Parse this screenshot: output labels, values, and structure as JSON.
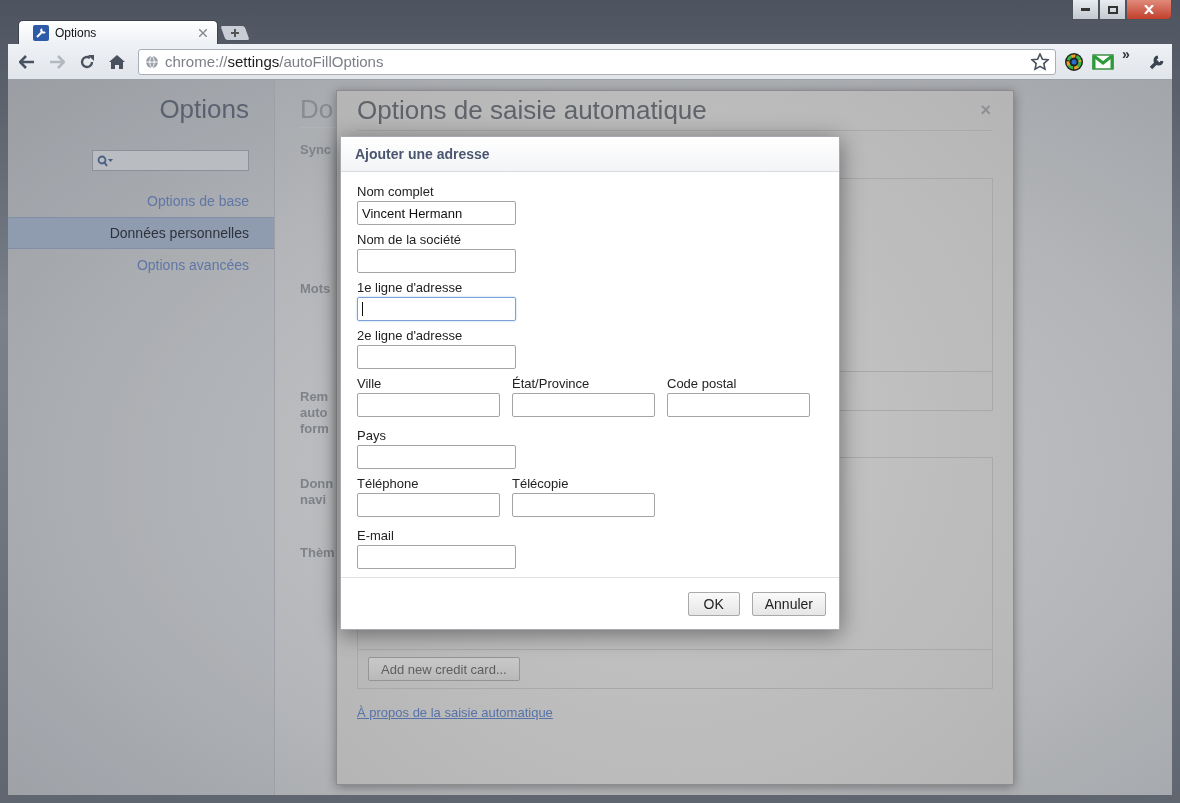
{
  "tab": {
    "title": "Options",
    "selected": true
  },
  "toolbar": {
    "buttons": [
      {
        "kind": "back",
        "disabled": false
      },
      {
        "kind": "forward",
        "disabled": true
      },
      {
        "kind": "reload",
        "disabled": false
      },
      {
        "kind": "home",
        "disabled": false
      }
    ],
    "url": {
      "scheme": "chrome://",
      "host": "settings",
      "path": "/autoFillOptions"
    },
    "overflow": "»"
  },
  "sidebar": {
    "title": "Options",
    "items": [
      {
        "label": "Options de base",
        "selected": false
      },
      {
        "label": "Données personnelles",
        "selected": true
      },
      {
        "label": "Options avancées",
        "selected": false
      }
    ]
  },
  "main": {
    "title": "Do",
    "sections": [
      {
        "lines": [
          "Sync"
        ]
      },
      {
        "lines": [
          "Mots"
        ]
      },
      {
        "lines": [
          "Rem",
          "auto",
          "form"
        ]
      },
      {
        "lines": [
          "Donn",
          "navi"
        ]
      },
      {
        "lines": [
          "Thèm"
        ]
      }
    ]
  },
  "autofill_dialog": {
    "title": "Options de saisie automatique",
    "close": "×",
    "add_card_button": "Add new credit card...",
    "link": "À propos de la saisie automatique"
  },
  "address_dialog": {
    "title": "Ajouter une adresse",
    "rows": [
      {
        "fields": [
          {
            "label": "Nom complet",
            "value": "Vincent Hermann",
            "focused": false
          }
        ]
      },
      {
        "fields": [
          {
            "label": "Nom de la société",
            "focused": false
          }
        ]
      },
      {
        "fields": [
          {
            "label": "1e ligne d'adresse",
            "focused": true
          }
        ]
      },
      {
        "fields": [
          {
            "label": "2e ligne d'adresse",
            "focused": false
          }
        ]
      },
      {
        "fields": [
          {
            "label": "Ville",
            "focused": false
          },
          {
            "label": "État/Province",
            "focused": false
          },
          {
            "label": "Code postal",
            "focused": false
          }
        ]
      },
      {
        "fields": [
          {
            "label": "Pays",
            "focused": false
          }
        ]
      },
      {
        "fields": [
          {
            "label": "Téléphone",
            "focused": false
          },
          {
            "label": "Télécopie",
            "focused": false
          }
        ]
      },
      {
        "fields": [
          {
            "label": "E-mail",
            "focused": false
          }
        ]
      }
    ],
    "buttons": [
      "OK",
      "Annuler"
    ]
  }
}
